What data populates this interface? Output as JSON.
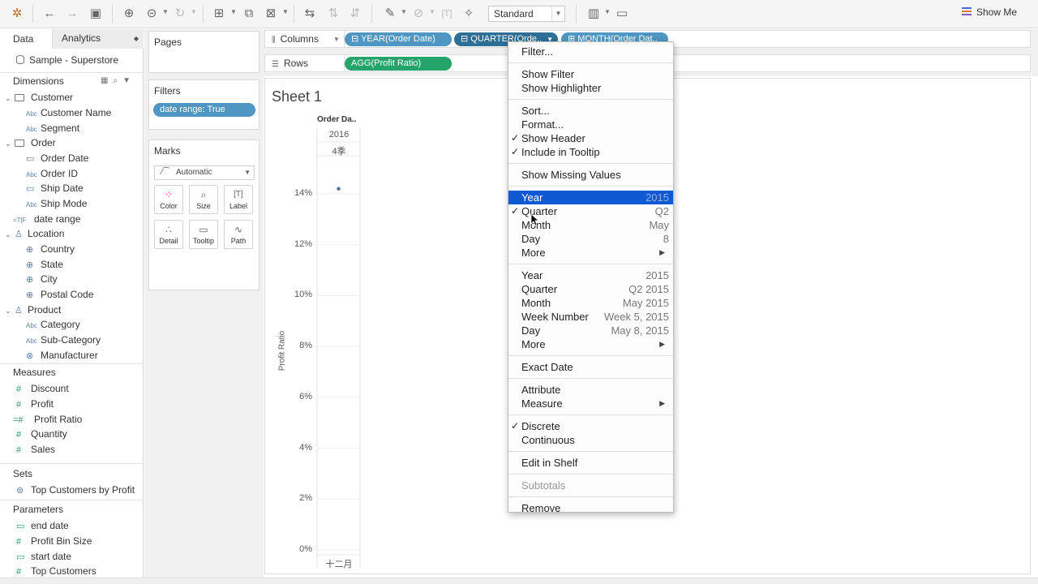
{
  "toolbar": {
    "view_mode": "Standard",
    "show_me": "Show Me",
    "icons": [
      "tableau-logo-icon",
      "undo-icon",
      "redo-icon",
      "save-icon",
      "new-datasource-icon",
      "pause-icon",
      "refresh-icon",
      "new-worksheet-icon",
      "duplicate-icon",
      "clear-icon",
      "swap-icon",
      "sort-asc-icon",
      "sort-desc-icon",
      "highlight-icon",
      "group-icon",
      "labels-icon",
      "pin-icon",
      "fit-icon",
      "presentation-icon"
    ]
  },
  "data_pane": {
    "tab_data": "Data",
    "tab_analytics": "Analytics",
    "datasource": "Sample - Superstore",
    "dimensions_header": "Dimensions",
    "dimensions": [
      {
        "label": "Customer",
        "kind": "folder"
      },
      {
        "label": "Customer Name",
        "kind": "abc"
      },
      {
        "label": "Segment",
        "kind": "abc"
      },
      {
        "label": "Order",
        "kind": "folder"
      },
      {
        "label": "Order Date",
        "kind": "date"
      },
      {
        "label": "Order ID",
        "kind": "abc"
      },
      {
        "label": "Ship Date",
        "kind": "date"
      },
      {
        "label": "Ship Mode",
        "kind": "abc"
      },
      {
        "label": "date range",
        "kind": "calc"
      },
      {
        "label": "Location",
        "kind": "hierarchy"
      },
      {
        "label": "Country",
        "kind": "geo"
      },
      {
        "label": "State",
        "kind": "geo"
      },
      {
        "label": "City",
        "kind": "geo"
      },
      {
        "label": "Postal Code",
        "kind": "geo"
      },
      {
        "label": "Product",
        "kind": "hierarchy"
      },
      {
        "label": "Category",
        "kind": "abc"
      },
      {
        "label": "Sub-Category",
        "kind": "abc"
      },
      {
        "label": "Manufacturer",
        "kind": "group"
      }
    ],
    "measures_header": "Measures",
    "measures": [
      "Discount",
      "Profit",
      "Profit Ratio",
      "Quantity",
      "Sales"
    ],
    "sets_header": "Sets",
    "sets": [
      "Top Customers by Profit"
    ],
    "parameters_header": "Parameters",
    "parameters": [
      "end date",
      "Profit Bin Size",
      "start date",
      "Top Customers"
    ]
  },
  "cards": {
    "pages_title": "Pages",
    "filters_title": "Filters",
    "filter_pill": "date range: True",
    "marks_title": "Marks",
    "mark_type": "Automatic",
    "mark_buttons": [
      "Color",
      "Size",
      "Label",
      "Detail",
      "Tooltip",
      "Path"
    ]
  },
  "shelves": {
    "columns_label": "Columns",
    "rows_label": "Rows",
    "column_pills": [
      "YEAR(Order Date)",
      "QUARTER(Orde..",
      "MONTH(Order Dat.."
    ],
    "row_pills": [
      "AGG(Profit Ratio)"
    ]
  },
  "sheet": {
    "title": "Sheet 1",
    "col_header": "Order Da..",
    "year": "2016",
    "quarter": "4季",
    "bottom_label": "十二月",
    "axis_title": "Profit Ratio"
  },
  "chart_data": {
    "type": "scatter",
    "categories": [
      "2016 / 4季 / 十二月"
    ],
    "values": [
      14.2
    ],
    "ylabel": "Profit Ratio",
    "yticks": [
      "0%",
      "2%",
      "4%",
      "6%",
      "8%",
      "10%",
      "12%",
      "14%"
    ],
    "ylim": [
      0,
      15.5
    ],
    "grid": true,
    "point_color": "#4e79a7"
  },
  "menu": {
    "items": [
      {
        "label": "Filter..."
      },
      {
        "sep": true
      },
      {
        "label": "Show Filter"
      },
      {
        "label": "Show Highlighter"
      },
      {
        "sep": true
      },
      {
        "label": "Sort..."
      },
      {
        "label": "Format..."
      },
      {
        "label": "Show Header",
        "checked": true
      },
      {
        "label": "Include in Tooltip",
        "checked": true
      },
      {
        "sep": true
      },
      {
        "label": "Show Missing Values"
      },
      {
        "sep": true
      },
      {
        "label": "Year",
        "value": "2015",
        "selected": true
      },
      {
        "label": "Quarter",
        "value": "Q2",
        "checked": true
      },
      {
        "label": "Month",
        "value": "May"
      },
      {
        "label": "Day",
        "value": "8"
      },
      {
        "label": "More",
        "arrow": true
      },
      {
        "sep": true
      },
      {
        "label": "Year",
        "value": "2015"
      },
      {
        "label": "Quarter",
        "value": "Q2 2015"
      },
      {
        "label": "Month",
        "value": "May 2015"
      },
      {
        "label": "Week Number",
        "value": "Week 5, 2015"
      },
      {
        "label": "Day",
        "value": "May 8, 2015"
      },
      {
        "label": "More",
        "arrow": true
      },
      {
        "sep": true
      },
      {
        "label": "Exact Date"
      },
      {
        "sep": true
      },
      {
        "label": "Attribute"
      },
      {
        "label": "Measure",
        "arrow": true
      },
      {
        "sep": true
      },
      {
        "label": "Discrete",
        "checked": true
      },
      {
        "label": "Continuous"
      },
      {
        "sep": true
      },
      {
        "label": "Edit in Shelf"
      },
      {
        "sep": true
      },
      {
        "label": "Subtotals",
        "disabled": true
      },
      {
        "sep": true
      },
      {
        "label": "Remove"
      }
    ]
  }
}
